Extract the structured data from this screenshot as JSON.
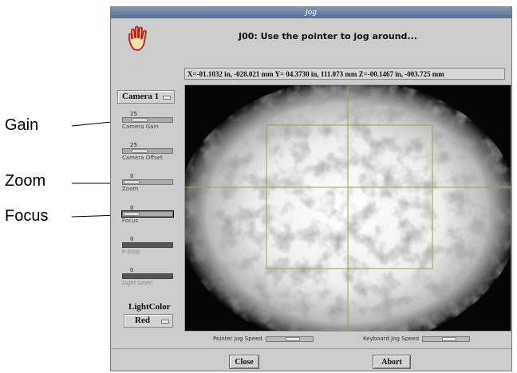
{
  "window": {
    "title": "Jog"
  },
  "header": {
    "instruction": "J00: Use the pointer to jog around..."
  },
  "coord_readout": "X=-01.1032 in, -028.021 mm  Y= 04.3730 in,  111.073 mm  Z=-00.1467 in, -003.725 mm",
  "camera_select": {
    "value": "Camera 1"
  },
  "sliders": [
    {
      "value": "25",
      "label": "Camera Gain",
      "fraction": 0.25,
      "enabled": true
    },
    {
      "value": "25",
      "label": "Camera Offset",
      "fraction": 0.25,
      "enabled": true
    },
    {
      "value": "0",
      "label": "Zoom",
      "fraction": 0.0,
      "enabled": true
    },
    {
      "value": "0",
      "label": "Focus",
      "fraction": 0.0,
      "enabled": true
    },
    {
      "value": "0",
      "label": "F-Stop",
      "fraction": 0.0,
      "enabled": false
    },
    {
      "value": "0",
      "label": "Light Level",
      "fraction": 0.0,
      "enabled": false
    }
  ],
  "light_color": {
    "label": "LightColor",
    "value": "Red"
  },
  "jog_speed": {
    "pointer_label": "Pointer Jog Speed",
    "keyboard_label": "Keyboard Jog Speed"
  },
  "buttons": {
    "close": "Close",
    "abort": "Abort"
  },
  "callouts": {
    "gain": "Gain",
    "zoom": "Zoom",
    "focus": "Focus"
  },
  "colors": {
    "titlebar": "#566e93",
    "crosshair": "#9aa64a",
    "panel": "#cccccc"
  },
  "icons": {
    "hand": "hand-icon"
  }
}
